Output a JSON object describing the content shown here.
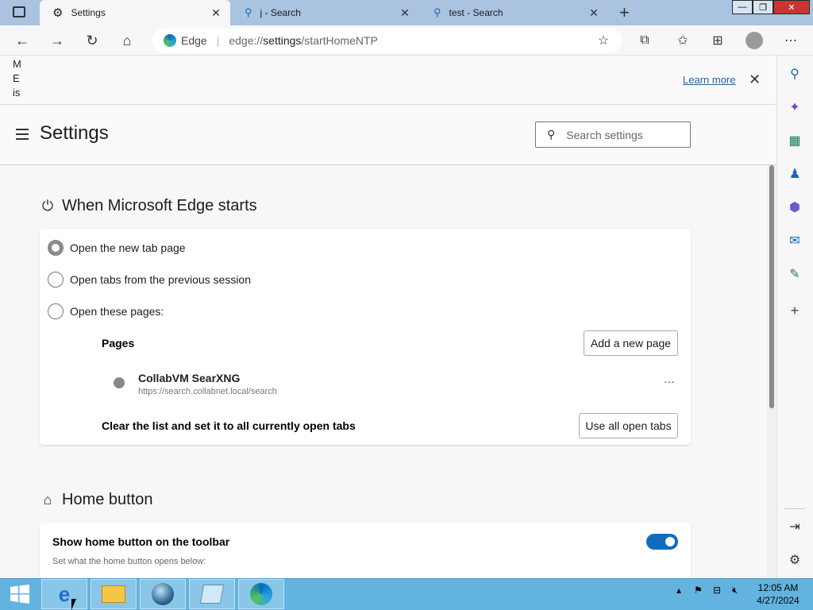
{
  "tabs": [
    {
      "label": "Settings",
      "icon": "gear-icon",
      "active": true
    },
    {
      "label": "j - Search",
      "icon": "search-icon",
      "active": false
    },
    {
      "label": "test - Search",
      "icon": "search-icon",
      "active": false
    }
  ],
  "window_controls": {
    "minimize": "—",
    "restore": "❐",
    "close": "✕"
  },
  "address_bar": {
    "brand": "Edge",
    "url_host": "edge://",
    "url_path_bold": "settings",
    "url_rest": "/startHomeNTP"
  },
  "infobar": {
    "vertical_text": [
      "M",
      "E",
      "is",
      "."
    ],
    "learn_more": "Learn more"
  },
  "header": {
    "title": "Settings",
    "search_placeholder": "Search settings"
  },
  "startup": {
    "title": "When Microsoft Edge starts",
    "options": [
      {
        "label": "Open the new tab page",
        "checked": true
      },
      {
        "label": "Open tabs from the previous session",
        "checked": false
      },
      {
        "label": "Open these pages:",
        "checked": false
      }
    ],
    "pages_label": "Pages",
    "add_page_button": "Add a new page",
    "page_entry": {
      "name": "CollabVM SearXNG",
      "url": "https://search.collabnet.local/search"
    },
    "more_glyph": "···",
    "clear_label": "Clear the list and set it to all currently open tabs",
    "use_open_tabs_button": "Use all open tabs"
  },
  "home_button": {
    "title": "Home button",
    "show_label": "Show home button on the toolbar",
    "sub_label": "Set what the home button opens below:",
    "toggle_on": true,
    "accent": "#0f6cbd"
  },
  "taskbar": {
    "time": "12:05 AM",
    "date": "4/27/2024"
  }
}
